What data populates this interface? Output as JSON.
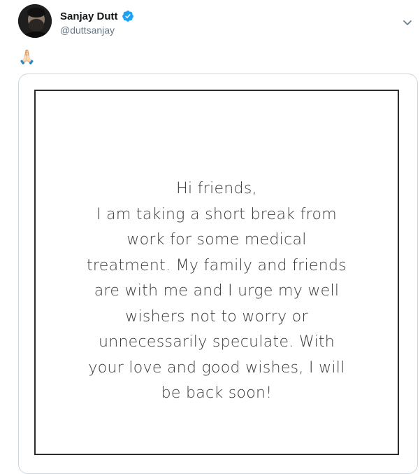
{
  "tweet": {
    "author": {
      "display_name": "Sanjay Dutt",
      "handle": "@duttsanjay",
      "verified": true,
      "avatar": "profile-photo"
    },
    "text": "🙏🏻",
    "menu_icon": "chevron-down-icon",
    "media": {
      "lines": [
        "Hi friends,",
        "I am taking a short break from",
        "work for some medical",
        "treatment. My family and friends",
        "are with me and I urge my well",
        "wishers not to worry or",
        "unnecessarily speculate. With",
        "your love and good wishes, I will",
        "be back soon!"
      ]
    }
  },
  "colors": {
    "verified": "#1da1f2",
    "handle": "#657786",
    "border": "#ccd6dd"
  }
}
